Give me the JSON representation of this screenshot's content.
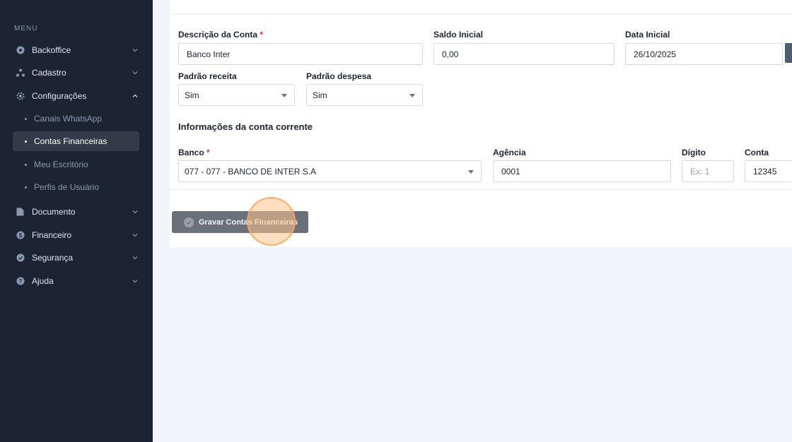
{
  "sidebar": {
    "menu_heading": "MENU",
    "items": [
      {
        "label": "Backoffice",
        "icon": "backoffice-icon"
      },
      {
        "label": "Cadastro",
        "icon": "cadastro-icon"
      },
      {
        "label": "Configurações",
        "icon": "gear-icon",
        "expanded": true
      },
      {
        "label": "Documento",
        "icon": "document-icon"
      },
      {
        "label": "Financeiro",
        "icon": "dollar-icon"
      },
      {
        "label": "Segurança",
        "icon": "shield-icon"
      },
      {
        "label": "Ajuda",
        "icon": "help-icon"
      }
    ],
    "subitems": [
      {
        "label": "Canais WhatsApp"
      },
      {
        "label": "Contas Financeiras",
        "active": true
      },
      {
        "label": "Meu Escritório"
      },
      {
        "label": "Perfis de Usuário"
      }
    ]
  },
  "form": {
    "descricao": {
      "label": "Descrição da Conta",
      "required": "*",
      "value": "Banco Inter"
    },
    "saldo": {
      "label": "Saldo Inicial",
      "value": "0,00"
    },
    "data_inicial": {
      "label": "Data Inicial",
      "value": "26/10/2025"
    },
    "padrao_receita": {
      "label": "Padrão receita",
      "value": "Sim"
    },
    "padrao_despesa": {
      "label": "Padrão despesa",
      "value": "Sim"
    },
    "section_title": "Informações da conta corrente",
    "banco": {
      "label": "Banco",
      "required": "*",
      "value": "077 - 077 - BANCO DE INTER S.A"
    },
    "agencia": {
      "label": "Agência",
      "value": "0001"
    },
    "digito": {
      "label": "Dígito",
      "placeholder": "Ex: 1"
    },
    "conta": {
      "label": "Conta",
      "value": "12345"
    },
    "save_label": "Gravar Contas Financeiras"
  },
  "colors": {
    "sidebar_bg": "#1c2434",
    "active_bg": "#333a48",
    "required": "#dc3545",
    "button_bg": "#6b717b",
    "click_highlight": "#f7a65c"
  }
}
